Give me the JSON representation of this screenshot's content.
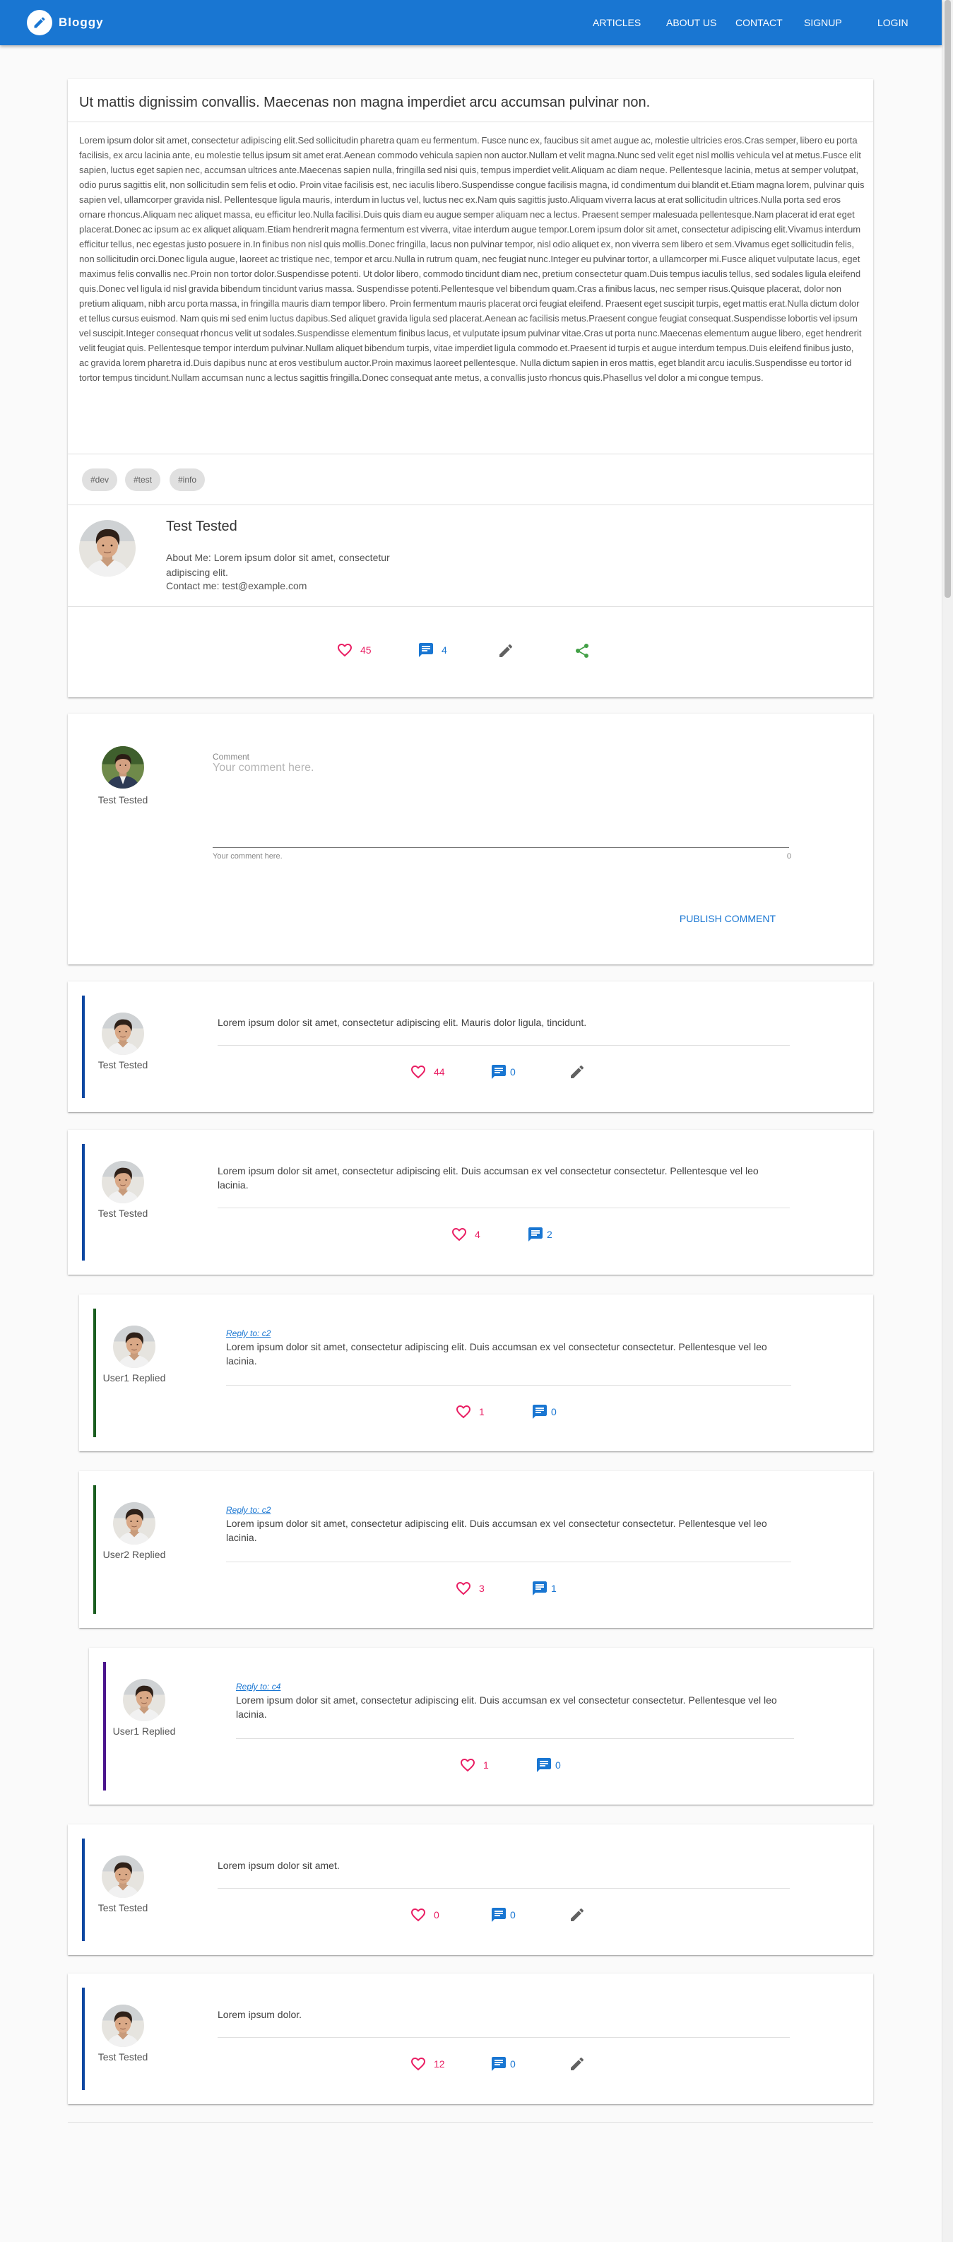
{
  "app": {
    "brand": "Bloggy"
  },
  "nav": {
    "articles": "ARTICLES",
    "about": "ABOUT US",
    "contact": "CONTACT",
    "signup": "SIGNUP",
    "login": "LOGIN"
  },
  "post": {
    "title": "Ut mattis dignissim convallis. Maecenas non magna imperdiet arcu accumsan pulvinar non.",
    "body": "Lorem ipsum dolor sit amet, consectetur adipiscing elit.Sed sollicitudin pharetra quam eu fermentum. Fusce nunc ex, faucibus sit amet augue ac, molestie ultricies eros.Cras semper, libero eu porta facilisis, ex arcu lacinia ante, eu molestie tellus ipsum sit amet erat.Aenean commodo vehicula sapien non auctor.Nullam et velit magna.Nunc sed velit eget nisl mollis vehicula vel at metus.Fusce elit sapien, luctus eget sapien nec, accumsan ultrices ante.Maecenas sapien nulla, fringilla sed nisi quis, tempus imperdiet velit.Aliquam ac diam neque. Pellentesque lacinia, metus at semper volutpat, odio purus sagittis elit, non sollicitudin sem felis et odio. Proin vitae facilisis est, nec iaculis libero.Suspendisse congue facilisis magna, id condimentum dui blandit et.Etiam magna lorem, pulvinar quis sapien vel, ullamcorper gravida nisl. Pellentesque ligula mauris, interdum in luctus vel, luctus nec ex.Nam quis sagittis justo.Aliquam viverra lacus at erat sollicitudin ultrices.Nulla porta sed eros ornare rhoncus.Aliquam nec aliquet massa, eu efficitur leo.Nulla facilisi.Duis quis diam eu augue semper aliquam nec a lectus. Praesent semper malesuada pellentesque.Nam placerat id erat eget placerat.Donec ac ipsum ac ex aliquet aliquam.Etiam hendrerit magna fermentum est viverra, vitae interdum augue tempor.Lorem ipsum dolor sit amet, consectetur adipiscing elit.Vivamus interdum efficitur tellus, nec egestas justo posuere in.In finibus non nisl quis mollis.Donec fringilla, lacus non pulvinar tempor, nisl odio aliquet ex, non viverra sem libero et sem.Vivamus eget sollicitudin felis, non sollicitudin orci.Donec ligula augue, laoreet ac tristique nec, tempor et arcu.Nulla in rutrum quam, nec feugiat nunc.Integer eu pulvinar tortor, a ullamcorper mi.Fusce aliquet vulputate lacus, eget maximus felis convallis nec.Proin non tortor dolor.Suspendisse potenti. Ut dolor libero, commodo tincidunt diam nec, pretium consectetur quam.Duis tempus iaculis tellus, sed sodales ligula eleifend quis.Donec vel ligula id nisl gravida bibendum tincidunt varius massa. Suspendisse potenti.Pellentesque vel bibendum quam.Cras a finibus lacus, nec semper risus.Quisque placerat, dolor non pretium aliquam, nibh arcu porta massa, in fringilla mauris diam tempor libero. Proin fermentum mauris placerat orci feugiat eleifend. Praesent eget suscipit turpis, eget mattis erat.Nulla dictum dolor et tellus cursus euismod. Nam quis mi sed enim luctus dapibus.Sed aliquet gravida ligula sed placerat.Aenean ac facilisis metus.Praesent congue feugiat consequat.Suspendisse lobortis vel ipsum vel suscipit.Integer consequat rhoncus velit ut sodales.Suspendisse elementum finibus lacus, et vulputate ipsum pulvinar vitae.Cras ut porta nunc.Maecenas elementum augue libero, eget hendrerit velit feugiat quis. Pellentesque tempor interdum pulvinar.Nullam aliquet bibendum turpis, vitae imperdiet ligula commodo et.Praesent id turpis et augue interdum tempus.Duis eleifend finibus justo, ac gravida lorem pharetra id.Duis dapibus nunc at eros vestibulum auctor.Proin maximus laoreet pellentesque. Nulla dictum sapien in eros mattis, eget blandit arcu iaculis.Suspendisse eu tortor id tortor tempus tincidunt.Nullam accumsan nunc a lectus sagittis fringilla.Donec consequat ante metus, a convallis justo rhoncus quis.Phasellus vel dolor a mi congue tempus.",
    "tags": [
      "#dev",
      "#test",
      "#info"
    ],
    "author": {
      "name": "Test Tested",
      "about": "About Me: Lorem ipsum dolor sit amet, consectetur adipiscing elit.",
      "contact": "Contact me: test@example.com"
    },
    "likes": "45",
    "comments": "4"
  },
  "form": {
    "user": "Test Tested",
    "label": "Comment",
    "placeholder": "Your comment here.",
    "hint": "Your comment here.",
    "counter": "0",
    "publish": "PUBLISH COMMENT"
  },
  "comments": [
    {
      "user": "Test Tested",
      "text": "Lorem ipsum dolor sit amet, consectetur adipiscing elit. Mauris dolor ligula, tincidunt.",
      "likes": "44",
      "replies": "0"
    },
    {
      "user": "Test Tested",
      "text": "Lorem ipsum dolor sit amet, consectetur adipiscing elit. Duis accumsan ex vel consectetur consectetur. Pellentesque vel leo lacinia.",
      "likes": "4",
      "replies": "2"
    },
    {
      "user": "User1 Replied",
      "reply_to": "Reply to: c2",
      "text": "Lorem ipsum dolor sit amet, consectetur adipiscing elit. Duis accumsan ex vel consectetur consectetur. Pellentesque vel leo lacinia.",
      "likes": "1",
      "replies": "0"
    },
    {
      "user": "User2 Replied",
      "reply_to": "Reply to: c2",
      "text": "Lorem ipsum dolor sit amet, consectetur adipiscing elit. Duis accumsan ex vel consectetur consectetur. Pellentesque vel leo lacinia.",
      "likes": "3",
      "replies": "1"
    },
    {
      "user": "User1 Replied",
      "reply_to": "Reply to: c4",
      "text": "Lorem ipsum dolor sit amet, consectetur adipiscing elit. Duis accumsan ex vel consectetur consectetur. Pellentesque vel leo lacinia.",
      "likes": "1",
      "replies": "0"
    },
    {
      "user": "Test Tested",
      "text": "Lorem ipsum dolor sit amet.",
      "likes": "0",
      "replies": "0"
    },
    {
      "user": "Test Tested",
      "text": "Lorem ipsum dolor.",
      "likes": "12",
      "replies": "0"
    }
  ],
  "colors": {
    "primary": "#1976d2",
    "like": "#e91e63",
    "share": "#43a047",
    "bar_level0": "#0d47a1",
    "bar_level1": "#1b5e20",
    "bar_level2": "#4a148c"
  },
  "icons": {
    "brand": "pencil-icon",
    "like": "heart-outline-icon",
    "comment": "comment-icon",
    "edit": "pencil-icon",
    "share": "share-icon"
  }
}
